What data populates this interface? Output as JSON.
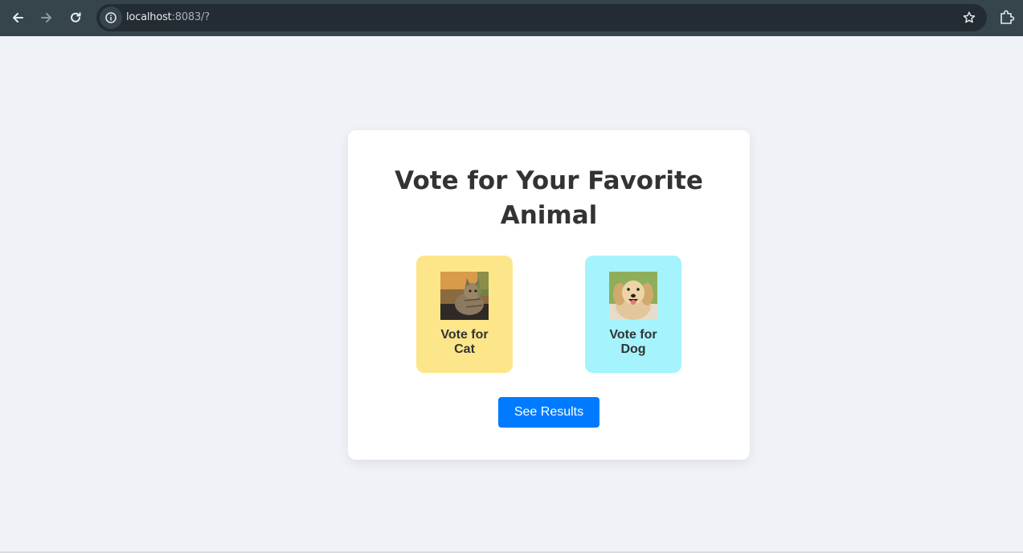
{
  "browser": {
    "url_host": "localhost",
    "url_rest": ":8083/?",
    "icons": [
      "back-arrow-icon",
      "forward-arrow-icon",
      "reload-icon",
      "info-icon",
      "star-icon",
      "extensions-icon"
    ]
  },
  "card": {
    "title": "Vote for Your Favorite Animal",
    "options": [
      {
        "label_line1": "Vote for",
        "label_line2": "Cat",
        "color": "#fde68a"
      },
      {
        "label_line1": "Vote for",
        "label_line2": "Dog",
        "color": "#a5f3fc"
      }
    ],
    "results_button": "See Results"
  },
  "colors": {
    "page_bg": "#eff2f6",
    "accent": "#007bff",
    "toolbar": "#36444c"
  }
}
